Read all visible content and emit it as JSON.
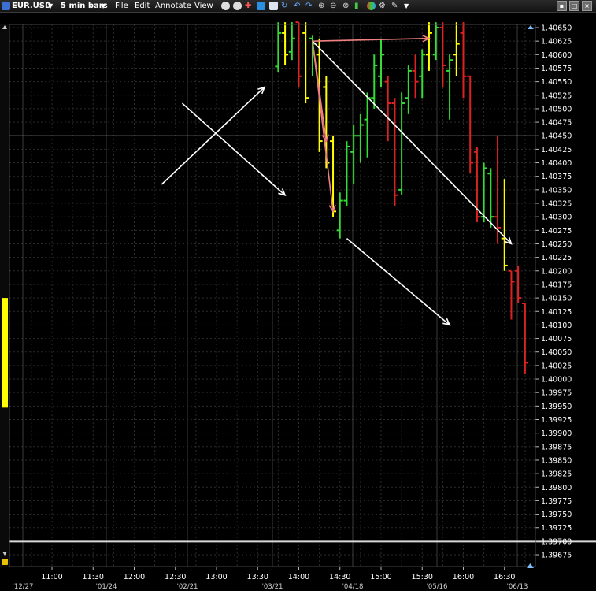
{
  "toolbar": {
    "symbol": "EUR.USD",
    "bar_size": "5 min bars",
    "menu": [
      "File",
      "Edit",
      "Annotate",
      "View"
    ],
    "icons": [
      "circle-icon",
      "circle-icon",
      "crosshair-icon",
      "calendar-icon",
      "chart-icon",
      "refresh-icon",
      "undo-icon",
      "redo-icon",
      "zoom-in-icon",
      "zoom-out-icon",
      "link-icon",
      "bar-chart-icon",
      "color-icon",
      "settings-icon",
      "wrench-icon",
      "dropdown-icon"
    ]
  },
  "colors": {
    "up": "#33dd33",
    "down": "#dd2222",
    "neutral": "#ffff00",
    "arrow_white": "#ffffff",
    "arrow_pink": "#f08080",
    "background": "#000000",
    "grid": "#2b2b2b"
  },
  "chart_data": {
    "type": "ohlc",
    "title": "",
    "instrument": "EUR.USD",
    "interval": "5 min bars",
    "ylim": [
      1.39655,
      1.40662
    ],
    "y_ticks": [
      "1.40650",
      "1.40625",
      "1.40600",
      "1.40575",
      "1.40550",
      "1.40525",
      "1.40500",
      "1.40475",
      "1.40450",
      "1.40425",
      "1.40400",
      "1.40375",
      "1.40350",
      "1.40325",
      "1.40300",
      "1.40275",
      "1.40250",
      "1.40225",
      "1.40200",
      "1.40175",
      "1.40150",
      "1.40125",
      "1.40100",
      "1.40075",
      "1.40050",
      "1.40025",
      "1.40000",
      "1.39975",
      "1.39950",
      "1.39925",
      "1.39900",
      "1.39875",
      "1.39850",
      "1.39825",
      "1.39800",
      "1.39775",
      "1.39750",
      "1.39725",
      "1.39700",
      "1.39675"
    ],
    "x_ticks": [
      "11:00",
      "11:30",
      "12:00",
      "12:30",
      "13:00",
      "13:30",
      "14:00",
      "14:30",
      "15:00",
      "15:30",
      "16:00",
      "16:30"
    ],
    "date_ticks": [
      "'12/27",
      "'01/24",
      "'02/21",
      "'03/21",
      "'04/18",
      "'05/16",
      "'06/13"
    ],
    "current_price": 1.4045,
    "reference_level": 1.397,
    "bars": [
      {
        "time": "13:45",
        "open": 1.40578,
        "high": 1.4066,
        "low": 1.40568,
        "close": 1.4064,
        "color": "up"
      },
      {
        "time": "13:50",
        "open": 1.4064,
        "high": 1.4066,
        "low": 1.4058,
        "close": 1.406,
        "color": "neutral"
      },
      {
        "time": "13:55",
        "open": 1.40605,
        "high": 1.4066,
        "low": 1.4059,
        "close": 1.4063,
        "color": "up"
      },
      {
        "time": "14:00",
        "open": 1.4066,
        "high": 1.4066,
        "low": 1.4054,
        "close": 1.4056,
        "color": "down"
      },
      {
        "time": "14:05",
        "open": 1.4064,
        "high": 1.4066,
        "low": 1.4051,
        "close": 1.4052,
        "color": "neutral"
      },
      {
        "time": "14:10",
        "open": 1.4063,
        "high": 1.40635,
        "low": 1.4056,
        "close": 1.4062,
        "color": "up"
      },
      {
        "time": "14:15",
        "open": 1.406,
        "high": 1.4063,
        "low": 1.4042,
        "close": 1.4044,
        "color": "neutral"
      },
      {
        "time": "14:20",
        "open": 1.4054,
        "high": 1.4056,
        "low": 1.4039,
        "close": 1.404,
        "color": "neutral"
      },
      {
        "time": "14:25",
        "open": 1.4044,
        "high": 1.4045,
        "low": 1.403,
        "close": 1.4031,
        "color": "neutral"
      },
      {
        "time": "14:30",
        "open": 1.40275,
        "high": 1.40345,
        "low": 1.4026,
        "close": 1.4033,
        "color": "up"
      },
      {
        "time": "14:35",
        "open": 1.4033,
        "high": 1.4044,
        "low": 1.4032,
        "close": 1.4043,
        "color": "up"
      },
      {
        "time": "14:40",
        "open": 1.4042,
        "high": 1.4047,
        "low": 1.4036,
        "close": 1.4045,
        "color": "up"
      },
      {
        "time": "14:45",
        "open": 1.4045,
        "high": 1.4049,
        "low": 1.404,
        "close": 1.4047,
        "color": "up"
      },
      {
        "time": "14:50",
        "open": 1.4048,
        "high": 1.4053,
        "low": 1.4041,
        "close": 1.4052,
        "color": "up"
      },
      {
        "time": "14:55",
        "open": 1.4052,
        "high": 1.406,
        "low": 1.405,
        "close": 1.4058,
        "color": "up"
      },
      {
        "time": "15:00",
        "open": 1.4056,
        "high": 1.4063,
        "low": 1.4054,
        "close": 1.406,
        "color": "up"
      },
      {
        "time": "15:05",
        "open": 1.4055,
        "high": 1.4056,
        "low": 1.4044,
        "close": 1.4051,
        "color": "down"
      },
      {
        "time": "15:10",
        "open": 1.4051,
        "high": 1.4052,
        "low": 1.4032,
        "close": 1.4034,
        "color": "down"
      },
      {
        "time": "15:15",
        "open": 1.4035,
        "high": 1.4053,
        "low": 1.4034,
        "close": 1.4051,
        "color": "up"
      },
      {
        "time": "15:20",
        "open": 1.4052,
        "high": 1.4058,
        "low": 1.4049,
        "close": 1.4057,
        "color": "up"
      },
      {
        "time": "15:25",
        "open": 1.4057,
        "high": 1.406,
        "low": 1.4052,
        "close": 1.4055,
        "color": "down"
      },
      {
        "time": "15:30",
        "open": 1.4056,
        "high": 1.4061,
        "low": 1.4052,
        "close": 1.406,
        "color": "up"
      },
      {
        "time": "15:35",
        "open": 1.406,
        "high": 1.4066,
        "low": 1.4057,
        "close": 1.4064,
        "color": "neutral"
      },
      {
        "time": "15:40",
        "open": 1.406,
        "high": 1.4066,
        "low": 1.4059,
        "close": 1.4065,
        "color": "up"
      },
      {
        "time": "15:45",
        "open": 1.4065,
        "high": 1.4066,
        "low": 1.4054,
        "close": 1.4058,
        "color": "down"
      },
      {
        "time": "15:50",
        "open": 1.4057,
        "high": 1.406,
        "low": 1.4048,
        "close": 1.4059,
        "color": "up"
      },
      {
        "time": "15:55",
        "open": 1.406,
        "high": 1.4066,
        "low": 1.4056,
        "close": 1.4062,
        "color": "neutral"
      },
      {
        "time": "16:00",
        "open": 1.4064,
        "high": 1.4066,
        "low": 1.4052,
        "close": 1.4056,
        "color": "down"
      },
      {
        "time": "16:05",
        "open": 1.4056,
        "high": 1.4056,
        "low": 1.4038,
        "close": 1.404,
        "color": "down"
      },
      {
        "time": "16:10",
        "open": 1.4042,
        "high": 1.4043,
        "low": 1.4029,
        "close": 1.403,
        "color": "down"
      },
      {
        "time": "16:15",
        "open": 1.403,
        "high": 1.404,
        "low": 1.4029,
        "close": 1.4039,
        "color": "up"
      },
      {
        "time": "16:20",
        "open": 1.4038,
        "high": 1.4039,
        "low": 1.4028,
        "close": 1.403,
        "color": "up"
      },
      {
        "time": "16:25",
        "open": 1.403,
        "high": 1.4045,
        "low": 1.4025,
        "close": 1.4028,
        "color": "down"
      },
      {
        "time": "16:30",
        "open": 1.4026,
        "high": 1.4037,
        "low": 1.402,
        "close": 1.4021,
        "color": "neutral"
      },
      {
        "time": "16:35",
        "open": 1.402,
        "high": 1.402,
        "low": 1.4011,
        "close": 1.4018,
        "color": "down"
      },
      {
        "time": "16:40",
        "open": 1.402,
        "high": 1.4021,
        "low": 1.4014,
        "close": 1.4015,
        "color": "down"
      },
      {
        "time": "16:45",
        "open": 1.4014,
        "high": 1.4014,
        "low": 1.4001,
        "close": 1.4003,
        "color": "down"
      }
    ],
    "annotations": [
      {
        "type": "arrow",
        "color": "white",
        "from": {
          "time": "12:35",
          "price": 1.4051
        },
        "to": {
          "time": "13:50",
          "price": 1.4034
        }
      },
      {
        "type": "arrow",
        "color": "white",
        "from": {
          "time": "12:20",
          "price": 1.4036
        },
        "to": {
          "time": "13:35",
          "price": 1.4054
        }
      },
      {
        "type": "arrow",
        "color": "white",
        "from": {
          "time": "14:10",
          "price": 1.40625
        },
        "to": {
          "time": "16:35",
          "price": 1.4025
        }
      },
      {
        "type": "arrow",
        "color": "white",
        "from": {
          "time": "14:35",
          "price": 1.4026
        },
        "to": {
          "time": "15:50",
          "price": 1.401
        }
      },
      {
        "type": "arrow",
        "color": "pink",
        "from": {
          "time": "14:10",
          "price": 1.40625
        },
        "to": {
          "time": "15:35",
          "price": 1.4063
        }
      },
      {
        "type": "arrow",
        "color": "pink",
        "from": {
          "time": "14:10",
          "price": 1.40625
        },
        "to": {
          "time": "14:20",
          "price": 1.4044
        }
      },
      {
        "type": "arrow",
        "color": "pink",
        "from": {
          "time": "14:10",
          "price": 1.40625
        },
        "to": {
          "time": "14:25",
          "price": 1.4031
        }
      }
    ]
  }
}
